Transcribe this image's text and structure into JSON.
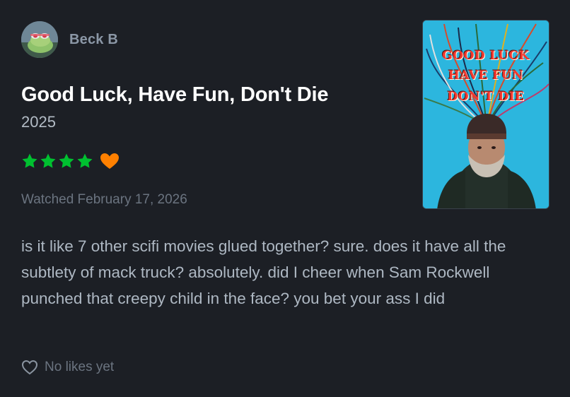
{
  "review": {
    "user": {
      "name": "Beck B",
      "avatar_icon": "frog-avatar-icon"
    },
    "film": {
      "title": "Good Luck, Have Fun, Don't Die",
      "year": "2025"
    },
    "rating": {
      "stars": 4,
      "max_stars": 5,
      "liked": true,
      "star_color": "#00c030",
      "heart_color": "#ff8000"
    },
    "watched_text": "Watched February 17, 2026",
    "body": "is it like 7 other scifi movies glued together? sure. does it have all the subtlety of mack truck? absolutely. did I cheer when Sam Rockwell punched that creepy child in the face? you bet your ass I did",
    "likes_text": "No likes yet",
    "poster": {
      "lines": [
        "GOOD LUCK",
        "HAVE FUN",
        "DON'T DIE"
      ]
    }
  }
}
